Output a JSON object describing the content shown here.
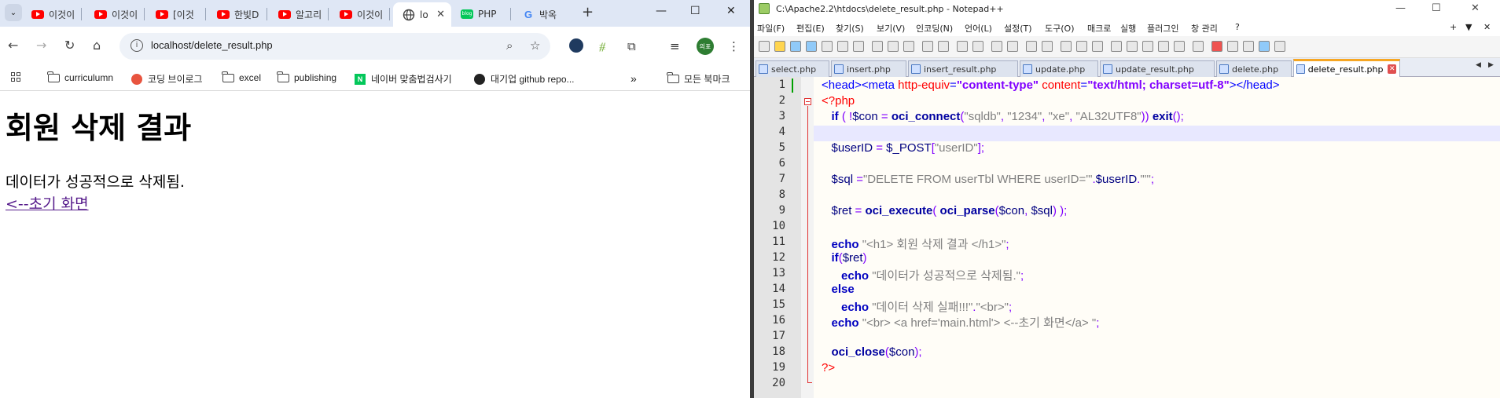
{
  "chrome": {
    "tabs": [
      {
        "label": "이것이",
        "icon": "youtube"
      },
      {
        "label": "이것이",
        "icon": "youtube"
      },
      {
        "label": "[이것",
        "icon": "youtube"
      },
      {
        "label": "한빛D",
        "icon": "youtube"
      },
      {
        "label": "알고리",
        "icon": "youtube"
      },
      {
        "label": "이것이",
        "icon": "youtube"
      },
      {
        "label": "lo",
        "icon": "globe",
        "active": true
      },
      {
        "label": "PHP",
        "icon": "naver-blog"
      },
      {
        "label": "박옥",
        "icon": "google"
      }
    ],
    "url": "localhost/delete_result.php",
    "bookmarks": [
      {
        "label": "curriculumn",
        "icon": "folder"
      },
      {
        "label": "코딩 브이로그",
        "icon": "tistory"
      },
      {
        "label": "excel",
        "icon": "folder"
      },
      {
        "label": "publishing",
        "icon": "folder"
      },
      {
        "label": "네이버 맞춤법검사기",
        "icon": "naver"
      },
      {
        "label": "대기업 github repo...",
        "icon": "github"
      }
    ],
    "all_bookmarks": "모든 북마크",
    "avatar_text": "의표",
    "page": {
      "heading": "회원 삭제 결과",
      "message": "데이터가 성공적으로 삭제됨.",
      "link": "<--초기 화면"
    }
  },
  "notepad": {
    "title": "C:\\Apache2.2\\htdocs\\delete_result.php - Notepad++",
    "menu": [
      "파일(F)",
      "편집(E)",
      "찾기(S)",
      "보기(V)",
      "인코딩(N)",
      "언어(L)",
      "설정(T)",
      "도구(O)",
      "매크로",
      "실행",
      "플러그인",
      "창 관리",
      "?"
    ],
    "file_tabs": [
      "select.php",
      "insert.php",
      "insert_result.php",
      "update.php",
      "update_result.php",
      "delete.php",
      "delete_result.php"
    ],
    "active_tab": "delete_result.php",
    "line_numbers": [
      "1",
      "2",
      "3",
      "4",
      "5",
      "6",
      "7",
      "8",
      "9",
      "10",
      "11",
      "12",
      "13",
      "14",
      "15",
      "16",
      "17",
      "18",
      "19",
      "20"
    ]
  }
}
